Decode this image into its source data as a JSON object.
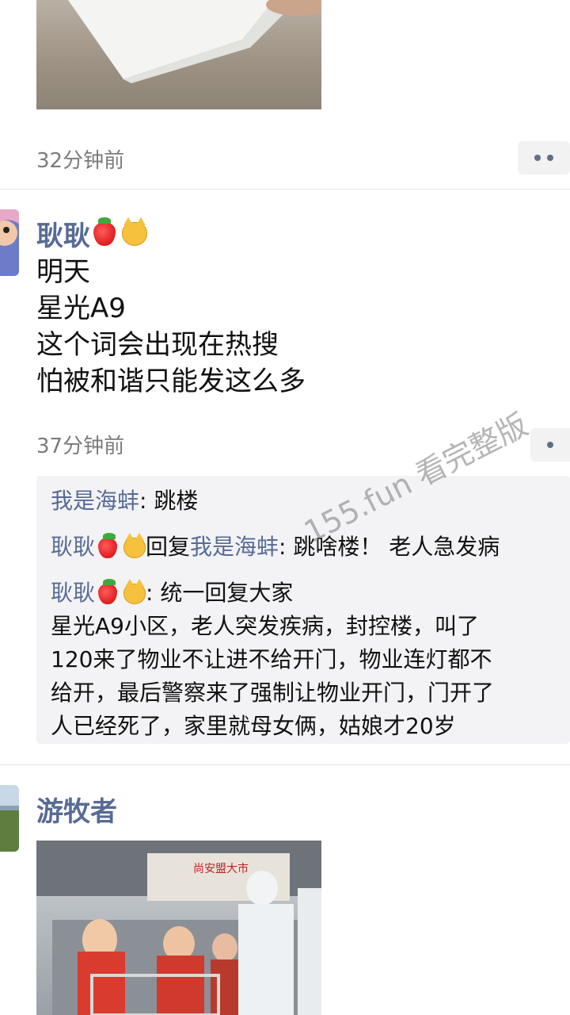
{
  "post1": {
    "time": "32分钟前"
  },
  "post2": {
    "author": "耿耿",
    "lines": [
      "明天",
      "星光A9",
      "这个词会出现在热搜",
      "怕被和谐只能发这么多"
    ],
    "time": "37分钟前",
    "comments": [
      {
        "name": "我是海蚌",
        "text": ": 跳楼"
      },
      {
        "name": "耿耿",
        "reply_word": "回复",
        "reply_to": "我是海蚌",
        "text": ": 跳啥楼！ 老人急发病"
      },
      {
        "name": "耿耿",
        "text": ": 统一回复大家",
        "extra_lines": [
          "星光A9小区，老人突发疾病，封控楼，叫了",
          "120来了物业不让进不给开门，物业连灯都不",
          "给开，最后警察来了强制让物业开门，门开了",
          "人已经死了，家里就母女俩，姑娘才20岁"
        ]
      }
    ]
  },
  "post3": {
    "author": "游牧者",
    "sign_text": "尚安盟大市"
  },
  "watermark": "155.fun 看完整版",
  "icons": {
    "more": "more-dots-icon",
    "strawberry": "strawberry-emoji-icon",
    "cat": "cat-emoji-icon"
  },
  "colors": {
    "name_link": "#576b95",
    "time": "#7b7b7b"
  }
}
